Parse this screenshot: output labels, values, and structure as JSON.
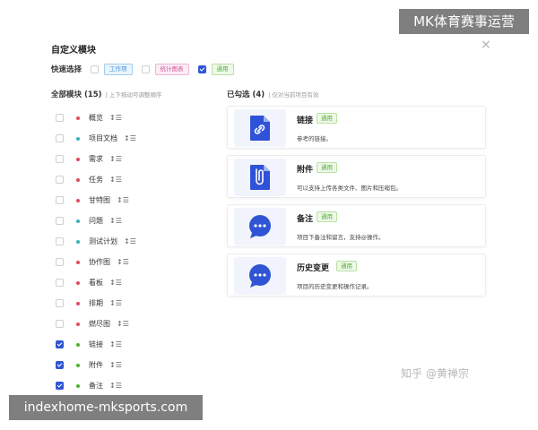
{
  "watermarks": {
    "top": "MK体育赛事运营",
    "bottom": "indexhome-mksports.com",
    "zhihu": "知乎 @黄禅宗"
  },
  "dialog": {
    "title": "自定义模块",
    "close": "×"
  },
  "quick_select": {
    "label": "快速选择",
    "options": [
      {
        "label": "工作项",
        "checked": false,
        "color": "#3a8fd9",
        "bg": "#eaf4fd",
        "border": "#9fcdf2"
      },
      {
        "label": "统计图表",
        "checked": false,
        "color": "#d0569b",
        "bg": "#fcedf5",
        "border": "#efb3d4"
      },
      {
        "label": "通用",
        "checked": true,
        "color": "#52b035",
        "bg": "#eef8e8",
        "border": "#b8e0a4"
      }
    ]
  },
  "all_modules": {
    "title": "全部模块 (15)",
    "hint": "上下拖动可调整顺序",
    "items": [
      {
        "name": "概览",
        "checked": false,
        "dot": "#e04a62"
      },
      {
        "name": "项目文档",
        "checked": false,
        "dot": "#3ab0b8"
      },
      {
        "name": "需求",
        "checked": false,
        "dot": "#e04a62"
      },
      {
        "name": "任务",
        "checked": false,
        "dot": "#e04a62"
      },
      {
        "name": "甘特图",
        "checked": false,
        "dot": "#e04a62"
      },
      {
        "name": "问题",
        "checked": false,
        "dot": "#3ab0b8"
      },
      {
        "name": "测试计划",
        "checked": false,
        "dot": "#3ab0b8"
      },
      {
        "name": "协作图",
        "checked": false,
        "dot": "#e04a62"
      },
      {
        "name": "看板",
        "checked": false,
        "dot": "#e04a62"
      },
      {
        "name": "排期",
        "checked": false,
        "dot": "#e04a62"
      },
      {
        "name": "燃尽图",
        "checked": false,
        "dot": "#e04a62"
      },
      {
        "name": "链接",
        "checked": true,
        "dot": "#52b035"
      },
      {
        "name": "附件",
        "checked": true,
        "dot": "#52b035"
      },
      {
        "name": "备注",
        "checked": true,
        "dot": "#52b035"
      }
    ]
  },
  "selected": {
    "title": "已勾选 (4)",
    "hint": "仅对当前项目有效",
    "cards": [
      {
        "name": "链接",
        "tag": "通用",
        "desc": "参考的链接。",
        "icon": "link-file-icon"
      },
      {
        "name": "附件",
        "tag": "通用",
        "desc": "可以支持上传各类文件、图片和压缩包。",
        "icon": "paperclip-file-icon"
      },
      {
        "name": "备注",
        "tag": "通用",
        "desc": "项目下备注和留言，支持@操作。",
        "icon": "chat-bubble-icon"
      },
      {
        "name": "历史变更",
        "tag": "通用",
        "desc": "项目的历史变更和操作记录。",
        "icon": "chat-bubble-icon"
      }
    ]
  }
}
